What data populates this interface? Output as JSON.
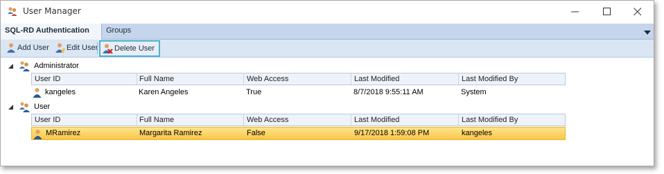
{
  "window": {
    "title": "User Manager",
    "icons": {
      "app": "users-app-icon",
      "minimize": "minimize-icon",
      "maximize": "maximize-icon",
      "close": "close-icon"
    }
  },
  "tabs": [
    {
      "label": "SQL-RD Authentication",
      "active": true
    },
    {
      "label": "Groups",
      "active": false
    }
  ],
  "toolbar": {
    "add_label": "Add User",
    "edit_label": "Edit User",
    "delete_label": "Delete User"
  },
  "columns": [
    "User ID",
    "Full Name",
    "Web Access",
    "Last Modified",
    "Last Modified By"
  ],
  "groups": [
    {
      "name": "Administrator",
      "expanded": true,
      "rows": [
        {
          "user_id": "kangeles",
          "full_name": "Karen Angeles",
          "web_access": "True",
          "last_modified": "8/7/2018 9:55:11 AM",
          "last_modified_by": "System",
          "selected": false
        }
      ]
    },
    {
      "name": "User",
      "expanded": true,
      "rows": [
        {
          "user_id": "MRamirez",
          "full_name": "Margarita Ramirez",
          "web_access": "False",
          "last_modified": "9/17/2018 1:59:08 PM",
          "last_modified_by": "kangeles",
          "selected": true
        }
      ]
    }
  ],
  "colors": {
    "tabstrip": "#c5d6ec",
    "toolbar": "#dbe6f4",
    "highlight_border": "#4db1d0",
    "selected_row": "#fbc64a"
  }
}
